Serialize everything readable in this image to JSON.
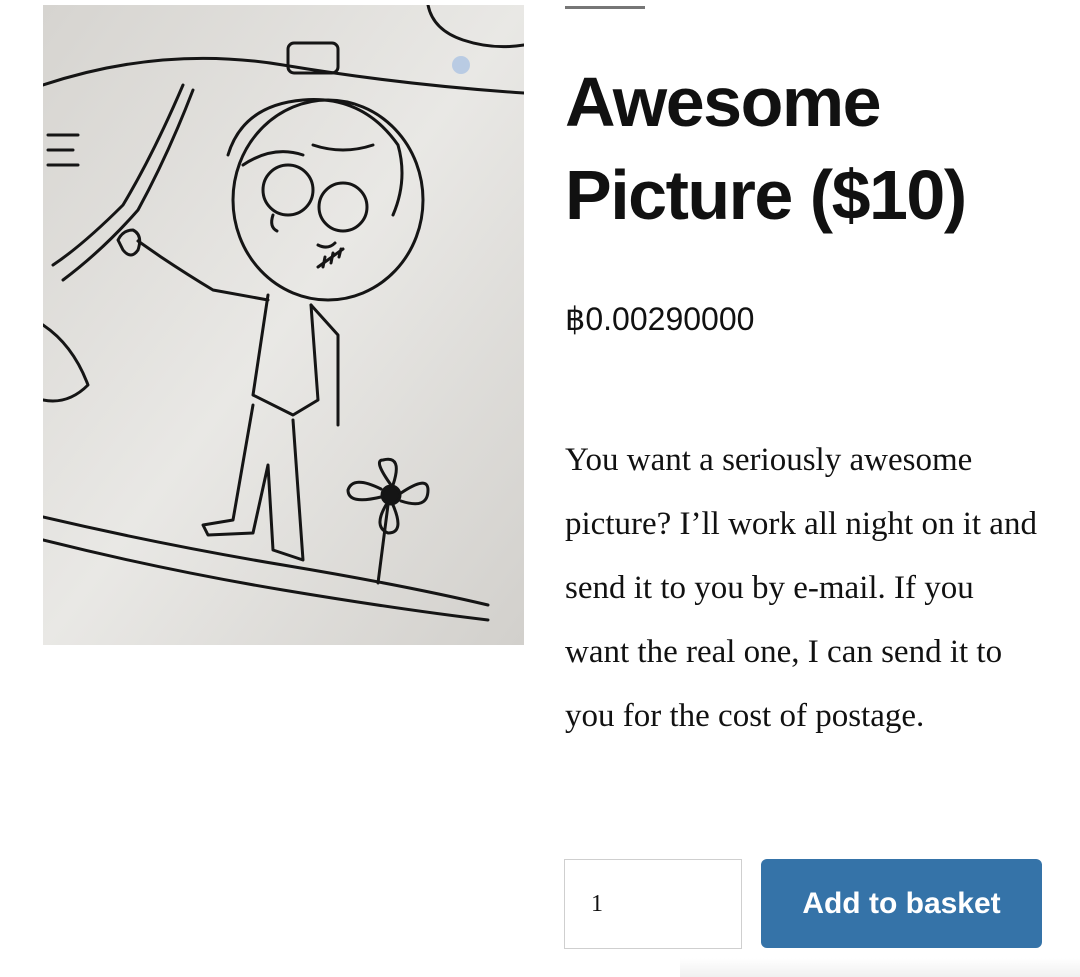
{
  "product": {
    "title": "Awesome Picture ($10)",
    "price": "฿0.00290000",
    "description": "You want a seriously awesome picture?  I’ll work all night on it and send it to you by e-mail.   If you want the real one, I can send it to you for the cost of postage.",
    "image_icon": "hand-drawn-picture"
  },
  "cart": {
    "quantity": "1",
    "add_label": "Add to basket",
    "button_color": "#3573a8"
  }
}
